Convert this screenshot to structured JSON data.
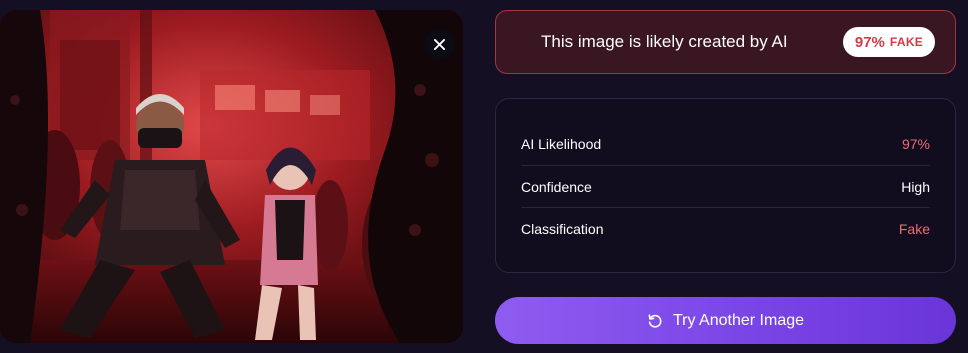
{
  "verdict": {
    "message": "This image is likely created by AI",
    "percent": "97%",
    "label": "FAKE"
  },
  "stats": [
    {
      "label": "AI Likelihood",
      "value": "97%"
    },
    {
      "label": "Confidence",
      "value": "High"
    },
    {
      "label": "Classification",
      "value": "Fake"
    }
  ],
  "actions": {
    "try_another_label": "Try Another Image"
  },
  "icons": {
    "close": "close-icon",
    "retry": "refresh-icon"
  },
  "colors": {
    "accent": "#7a45e6",
    "fake_red": "#d63a45",
    "verdict_border": "#a4353f"
  }
}
